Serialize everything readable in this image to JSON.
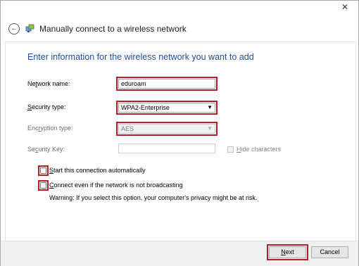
{
  "window": {
    "close_glyph": "✕",
    "title": "Manually connect to a wireless network",
    "back_glyph": "←"
  },
  "form": {
    "heading": "Enter information for the wireless network you want to add",
    "network_name": {
      "label_pre": "Ne",
      "label_key": "t",
      "label_post": "work name:",
      "value": "eduroam"
    },
    "security_type": {
      "label_key": "S",
      "label_post": "ecurity type:",
      "value": "WPA2-Enterprise"
    },
    "encryption_type": {
      "label_pre": "Enc",
      "label_key": "r",
      "label_post": "yption type:",
      "value": "AES"
    },
    "security_key": {
      "label_pre": "Se",
      "label_key": "c",
      "label_post": "urity Key:",
      "value": ""
    },
    "hide_characters": {
      "label_key": "H",
      "label_post": "ide characters",
      "checked": false
    },
    "start_auto": {
      "label_key": "S",
      "label_post": "tart this connection automatically",
      "checked": false
    },
    "connect_even": {
      "label_key": "C",
      "label_post": "onnect even if the network is not broadcasting",
      "checked": false
    },
    "warning": "Warning: If you select this option, your computer's privacy might be at risk."
  },
  "footer": {
    "next": {
      "label_key": "N",
      "label_post": "ext"
    },
    "cancel": "Cancel"
  },
  "colors": {
    "heading": "#1f4e9b",
    "highlight": "#b0202a"
  }
}
